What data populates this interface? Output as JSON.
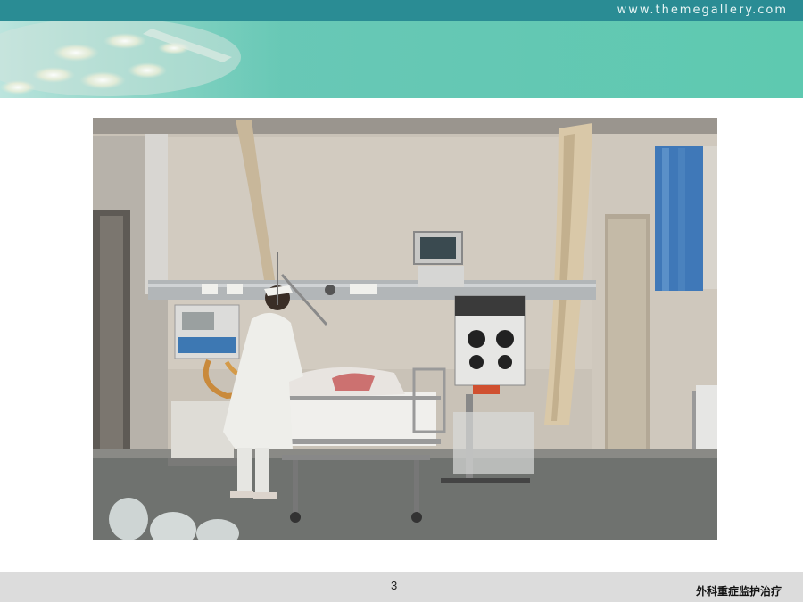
{
  "header": {
    "site_url": "www.themegallery.com"
  },
  "slide": {
    "page_number": "3",
    "footer_title": "外科重症监护治疗"
  },
  "colors": {
    "topbar": "#2a8c94",
    "banner": "#5ec9b0",
    "footer": "#dcdcdc"
  }
}
